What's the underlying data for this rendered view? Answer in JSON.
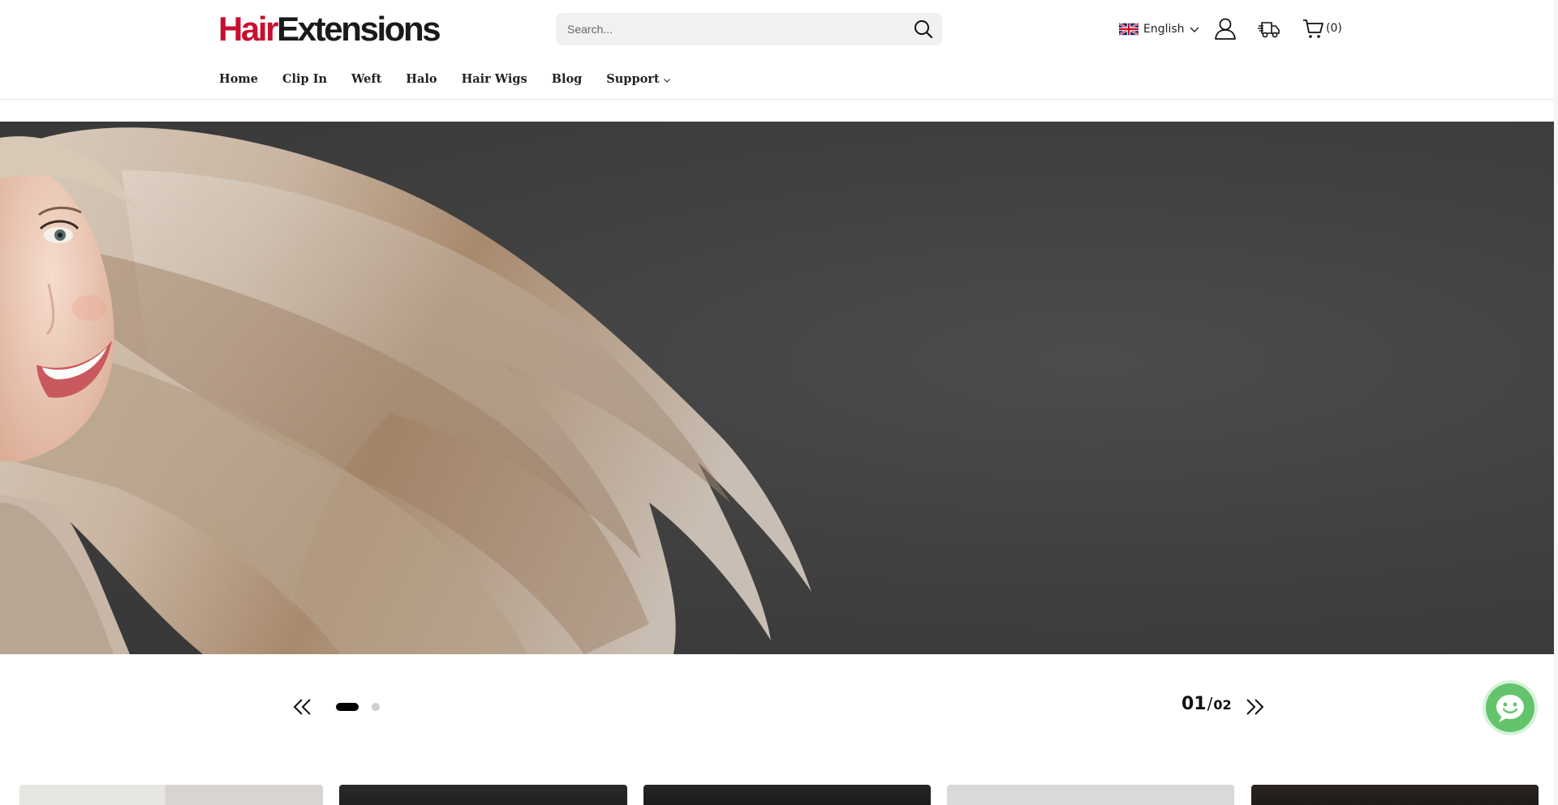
{
  "header": {
    "logo": {
      "part_a": "Hair",
      "part_b": "Extensions"
    },
    "search": {
      "placeholder": "Search..."
    },
    "language": {
      "label": "English",
      "flag": "uk-flag-icon"
    },
    "account_icon": "user-icon",
    "tracking_icon": "delivery-truck-icon",
    "cart": {
      "icon": "cart-icon",
      "count": "(0)"
    }
  },
  "nav": {
    "items": [
      {
        "label": "Home"
      },
      {
        "label": "Clip In"
      },
      {
        "label": "Weft"
      },
      {
        "label": "Halo"
      },
      {
        "label": "Hair Wigs"
      },
      {
        "label": "Blog"
      },
      {
        "label": "Support",
        "has_dropdown": true
      }
    ]
  },
  "hero": {
    "image": "blonde-woman-flowing-hair-banner"
  },
  "slider": {
    "current": "01",
    "separator": "/",
    "total": "02",
    "active_index": 0,
    "slide_count": 2
  },
  "chat": {
    "icon": "smiley-chat-icon"
  },
  "product_cards": {
    "count": 5
  },
  "colors": {
    "brand_red": "#c8102e",
    "logo_dark": "#1a1a1a",
    "hero_bg": "#414141",
    "chat_green": "#63c46b",
    "dot_active": "#000000",
    "dot_inactive": "#cfcfcf"
  }
}
